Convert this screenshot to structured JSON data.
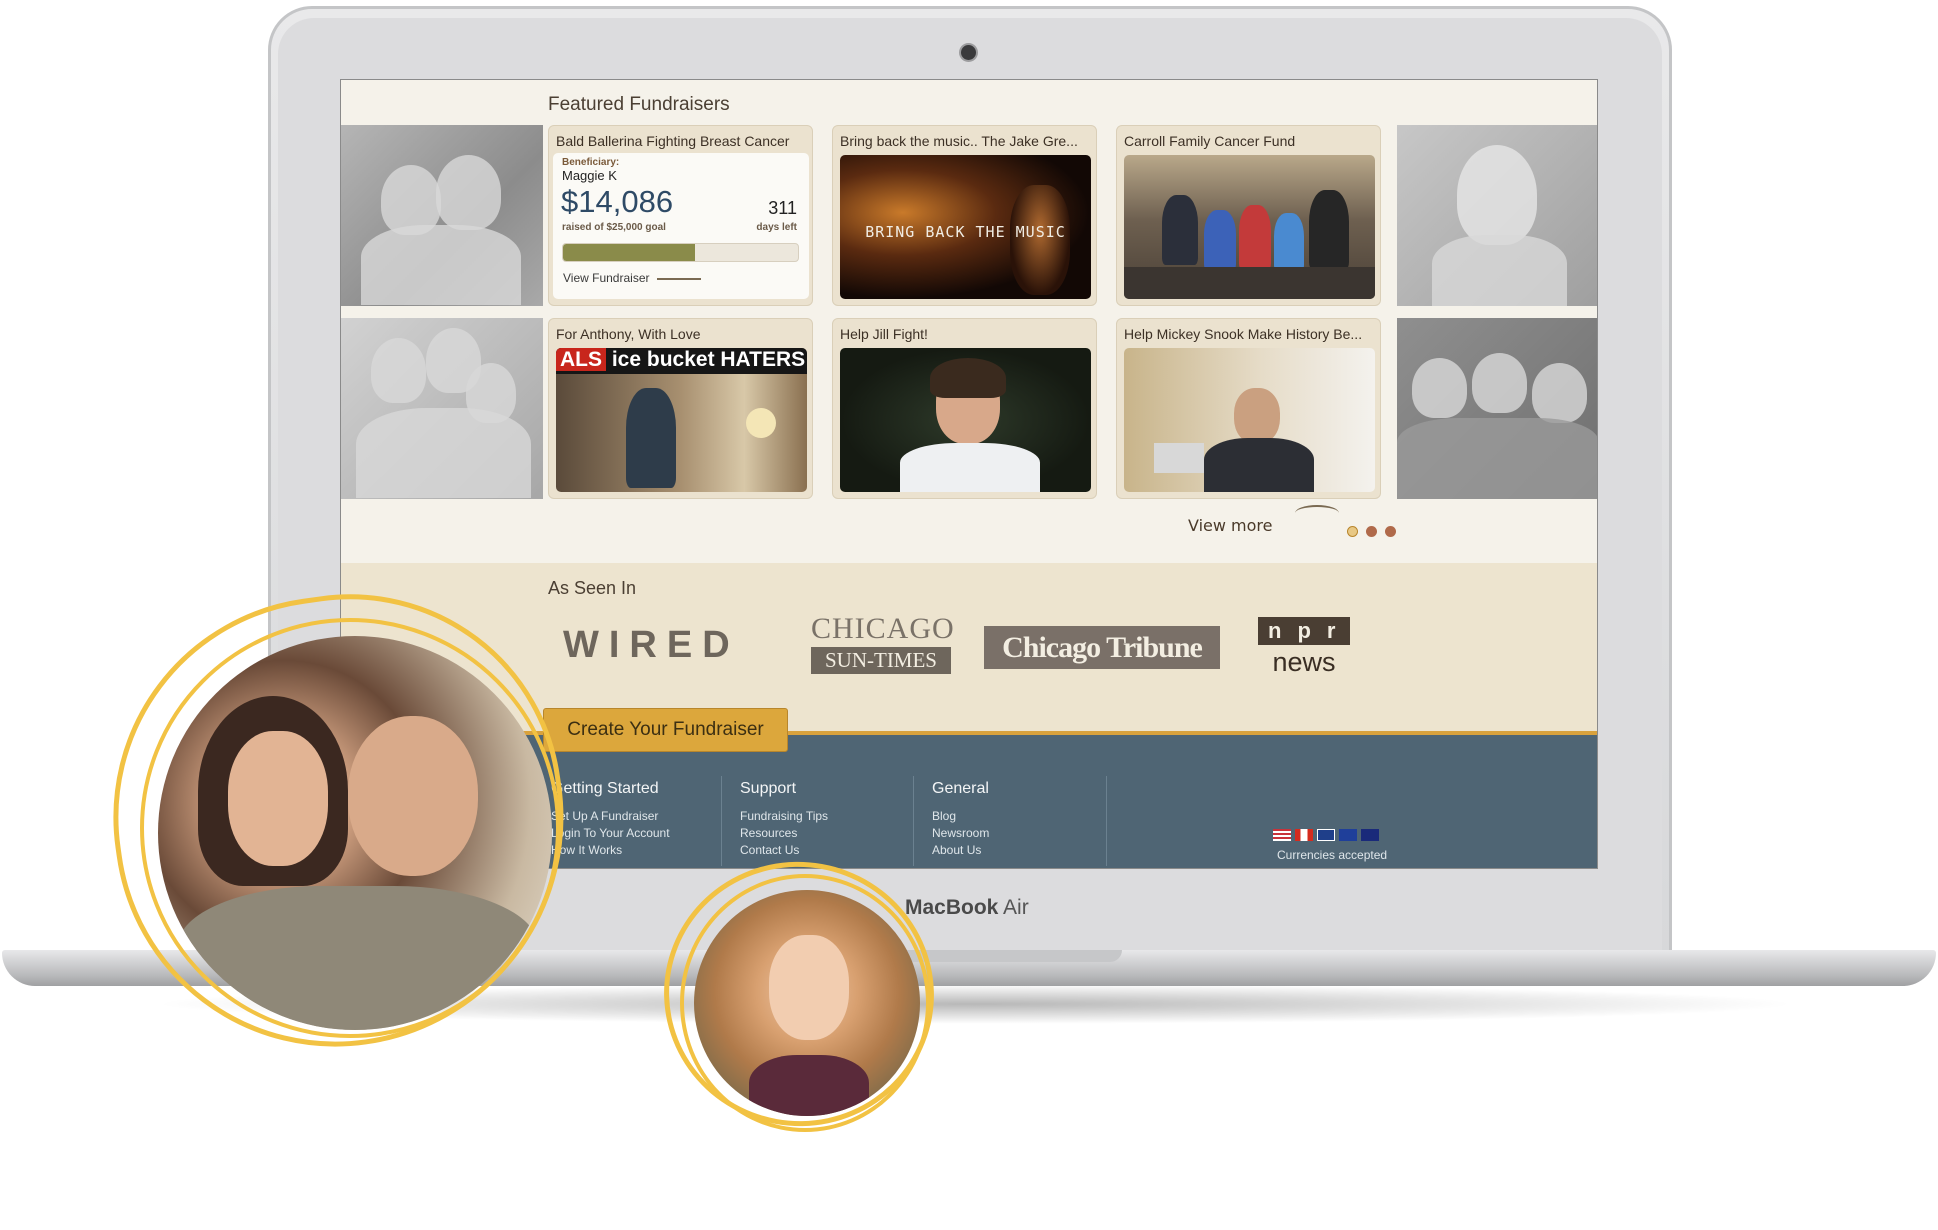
{
  "laptop": {
    "brand_bold": "MacBook",
    "brand_light": "Air"
  },
  "featured": {
    "title": "Featured Fundraisers",
    "cards": [
      {
        "title": "Bald Ballerina Fighting Breast Cancer",
        "beneficiary_label": "Beneficiary:",
        "beneficiary": "Maggie K",
        "amount": "$14,086",
        "goal": "raised of $25,000 goal",
        "days": "311",
        "days_label": "days left",
        "progress": 0.56,
        "link": "View Fundraiser"
      },
      {
        "title": "Bring back the music.. The Jake Gre...",
        "overlay": "BRING BACK THE MUSIC"
      },
      {
        "title": "Carroll Family Cancer Fund"
      },
      {
        "title": "For Anthony, With Love",
        "banner_red": "ALS",
        "banner_black": "ice bucket HATERS"
      },
      {
        "title": "Help Jill Fight!"
      },
      {
        "title": "Help Mickey Snook Make History Be..."
      }
    ],
    "view_more": "View more"
  },
  "press": {
    "title": "As Seen In",
    "logos": [
      "WIRED",
      "CHICAGO",
      "SUN-TIMES",
      "Chicago Tribune",
      "npr",
      "news"
    ]
  },
  "cta": {
    "label": "Create Your Fundraiser"
  },
  "footer": {
    "col1": {
      "heading": "Getting Started",
      "links": [
        "Set Up A Fundraiser",
        "Login To Your Account",
        "How It Works"
      ]
    },
    "col2": {
      "heading": "Support",
      "links": [
        "Fundraising Tips",
        "Resources",
        "Contact Us"
      ]
    },
    "col3": {
      "heading": "General",
      "links": [
        "Blog",
        "Newsroom",
        "About Us"
      ]
    },
    "currencies": "Currencies accepted"
  },
  "colors": {
    "accent": "#dca73c",
    "ring": "#f2c243",
    "footer": "#4f6574",
    "cream": "#f5f2ea"
  }
}
